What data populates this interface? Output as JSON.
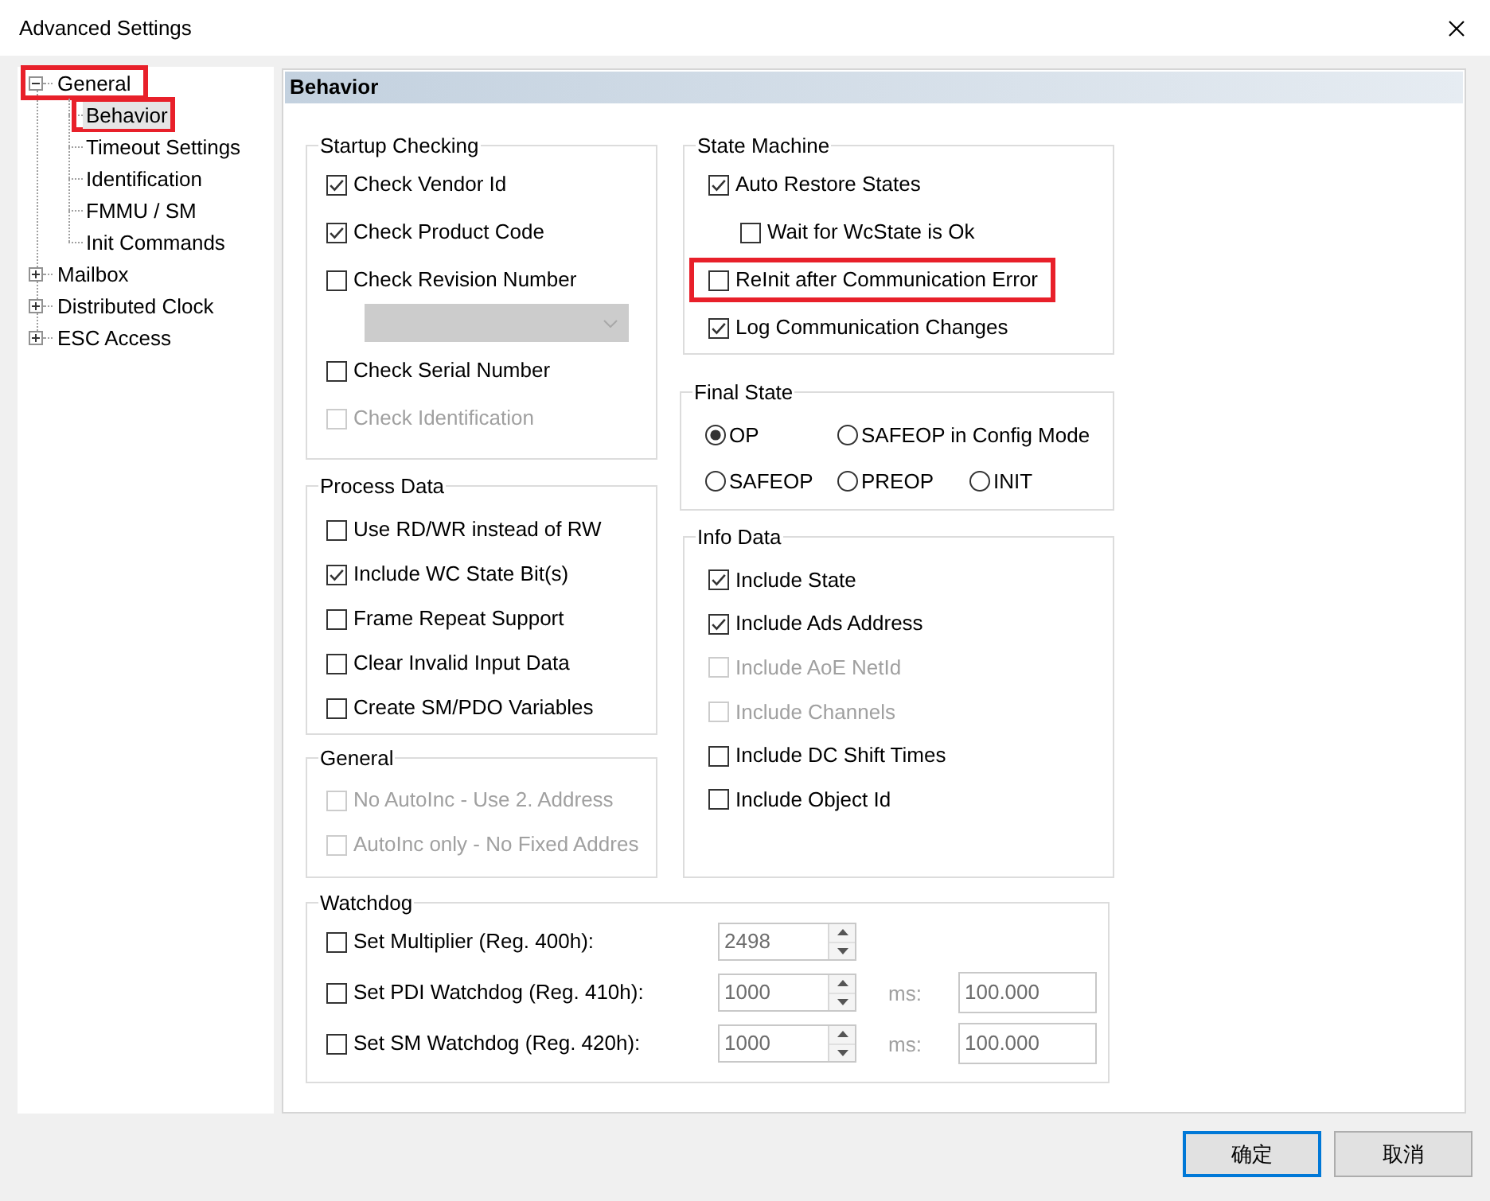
{
  "window": {
    "title": "Advanced Settings"
  },
  "tree": [
    {
      "label": "General",
      "expanded": true,
      "selected": false,
      "highlighted": true,
      "children": [
        {
          "label": "Behavior",
          "selected": true,
          "highlighted": true
        },
        {
          "label": "Timeout Settings",
          "selected": false,
          "highlighted": false
        },
        {
          "label": "Identification",
          "selected": false,
          "highlighted": false
        },
        {
          "label": "FMMU / SM",
          "selected": false,
          "highlighted": false
        },
        {
          "label": "Init Commands",
          "selected": false,
          "highlighted": false
        }
      ]
    },
    {
      "label": "Mailbox",
      "expanded": false,
      "selected": false,
      "highlighted": false
    },
    {
      "label": "Distributed Clock",
      "expanded": false,
      "selected": false,
      "highlighted": false
    },
    {
      "label": "ESC Access",
      "expanded": false,
      "selected": false,
      "highlighted": false
    }
  ],
  "panel": {
    "title": "Behavior"
  },
  "startup_checking": {
    "title": "Startup Checking",
    "options": [
      {
        "kind": "checkbox",
        "label": "Check Vendor Id",
        "checked": true,
        "disabled": false
      },
      {
        "kind": "checkbox",
        "label": "Check Product Code",
        "checked": true,
        "disabled": false
      },
      {
        "kind": "checkbox",
        "label": "Check Revision Number",
        "checked": false,
        "disabled": false
      },
      {
        "kind": "dropdown",
        "disabled": true
      },
      {
        "kind": "checkbox",
        "label": "Check Serial Number",
        "checked": false,
        "disabled": false
      },
      {
        "kind": "checkbox",
        "label": "Check Identification",
        "checked": false,
        "disabled": true
      }
    ]
  },
  "process_data": {
    "title": "Process Data",
    "options": [
      {
        "label": "Use RD/WR instead of RW",
        "checked": false,
        "disabled": false
      },
      {
        "label": "Include WC State Bit(s)",
        "checked": true,
        "disabled": false
      },
      {
        "label": "Frame Repeat Support",
        "checked": false,
        "disabled": false
      },
      {
        "label": "Clear Invalid Input Data",
        "checked": false,
        "disabled": false
      },
      {
        "label": "Create SM/PDO Variables",
        "checked": false,
        "disabled": false
      }
    ]
  },
  "general": {
    "title": "General",
    "options": [
      {
        "label": "No AutoInc - Use 2. Address",
        "checked": false,
        "disabled": true
      },
      {
        "label": "AutoInc only - No Fixed Addres",
        "checked": false,
        "disabled": true
      }
    ]
  },
  "state_machine": {
    "title": "State Machine",
    "options": [
      {
        "label": "Auto Restore States",
        "checked": true,
        "disabled": false,
        "highlighted": false,
        "children": [
          {
            "label": "Wait for WcState is Ok",
            "checked": false,
            "disabled": false,
            "highlighted": false
          }
        ]
      },
      {
        "label": "ReInit after Communication Error",
        "checked": false,
        "disabled": false,
        "highlighted": true
      },
      {
        "label": "Log Communication Changes",
        "checked": true,
        "disabled": false,
        "highlighted": false
      }
    ]
  },
  "final_state": {
    "title": "Final State",
    "rows": [
      [
        {
          "label": "OP",
          "selected": true
        },
        {
          "label": "SAFEOP in Config Mode",
          "selected": false
        }
      ],
      [
        {
          "label": "SAFEOP",
          "selected": false
        },
        {
          "label": "PREOP",
          "selected": false
        },
        {
          "label": "INIT",
          "selected": false
        }
      ]
    ]
  },
  "info_data": {
    "title": "Info Data",
    "options": [
      {
        "label": "Include State",
        "checked": true,
        "disabled": false
      },
      {
        "label": "Include Ads Address",
        "checked": true,
        "disabled": false
      },
      {
        "label": "Include AoE NetId",
        "checked": false,
        "disabled": true
      },
      {
        "label": "Include Channels",
        "checked": false,
        "disabled": true
      },
      {
        "label": "Include DC Shift Times",
        "checked": false,
        "disabled": false
      },
      {
        "label": "Include Object Id",
        "checked": false,
        "disabled": false
      }
    ]
  },
  "watchdog": {
    "title": "Watchdog",
    "rows": [
      {
        "label": "Set Multiplier (Reg. 400h):",
        "checked": false,
        "value": "2498",
        "fields_disabled": true
      },
      {
        "label": "Set PDI Watchdog (Reg. 410h):",
        "checked": false,
        "value": "1000",
        "fields_disabled": true,
        "unit": "ms:",
        "ms_value": "100.000"
      },
      {
        "label": "Set SM Watchdog (Reg. 420h):",
        "checked": false,
        "value": "1000",
        "fields_disabled": true,
        "unit": "ms:",
        "ms_value": "100.000"
      }
    ]
  },
  "buttons": [
    {
      "label": "确定",
      "default": true
    },
    {
      "label": "取消",
      "default": false
    }
  ]
}
